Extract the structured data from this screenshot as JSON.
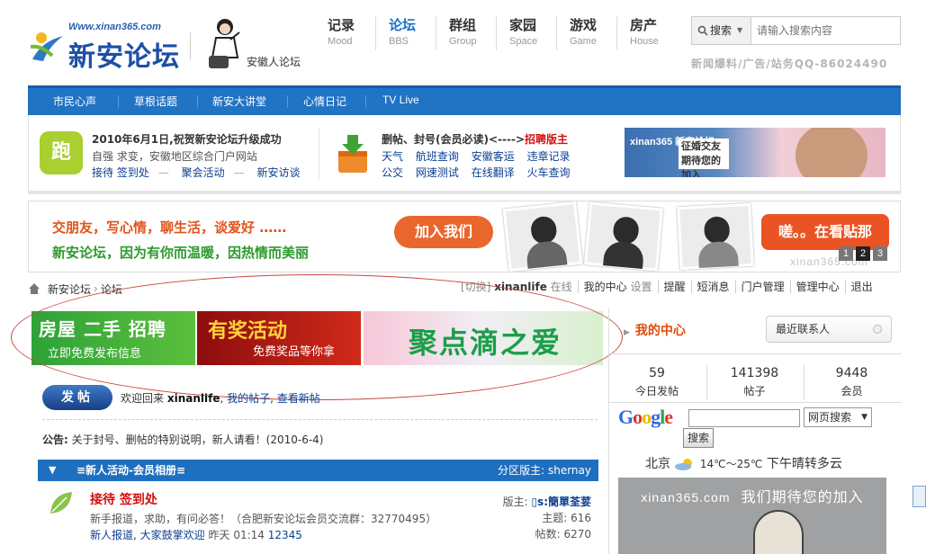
{
  "brand": {
    "url": "Www.xinan365.com",
    "name": "新安论坛",
    "sub_logo_text": "安徽人论坛"
  },
  "topnav": [
    {
      "cn": "记录",
      "en": "Mood",
      "active": false
    },
    {
      "cn": "论坛",
      "en": "BBS",
      "active": true
    },
    {
      "cn": "群组",
      "en": "Group",
      "active": false
    },
    {
      "cn": "家园",
      "en": "Space",
      "active": false
    },
    {
      "cn": "游戏",
      "en": "Game",
      "active": false
    },
    {
      "cn": "房产",
      "en": "House",
      "active": false
    }
  ],
  "search": {
    "type_label": "搜索",
    "placeholder": "请输入搜索内容",
    "hotline": "新闻爆料/广告/站务QQ-86024490"
  },
  "menu": [
    "市民心声",
    "草根话题",
    "新安大讲堂",
    "心情日记",
    "TV Live"
  ],
  "notice": {
    "icon1_text": "跑",
    "title1": "2010年6月1日,祝贺新安论坛升级成功",
    "line1": "自强 求变，安徽地区综合门户网站",
    "links1": [
      "接待 签到处",
      "聚会活动",
      "新安访谈"
    ],
    "title2_a": "删帖、封号(会员必读)<---->",
    "title2_b": "招聘版主",
    "links2_row1": [
      "天气",
      "航班查询",
      "安徽客运",
      "违章记录"
    ],
    "links2_row2": [
      "公交",
      "网速测试",
      "在线翻译",
      "火车查询"
    ],
    "ad_brand": "xinan365 新安论坛",
    "ad_text": "征婚交友 期待您的加入"
  },
  "banner": {
    "line1": "交朋友，写心情，聊生活，谈爱好 ……",
    "line2": "新安论坛，因为有你而温暖，因热情而美丽",
    "join": "加入我们",
    "look": "嗟。。在看贴那",
    "pages": [
      "1",
      "2",
      "3"
    ],
    "watermark": "xinan365.com"
  },
  "crumb": {
    "home": "新安论坛",
    "sep": "›",
    "current": "论坛"
  },
  "userbar": {
    "switch": "[切换]",
    "user": "xinanlife",
    "status": "在线",
    "items": [
      "我的中心",
      "设置",
      "提醒",
      "短消息",
      "门户管理",
      "管理中心",
      "退出"
    ]
  },
  "tiles": {
    "t1_big": "房屋 二手 招聘",
    "t1_small": "立即免费发布信息",
    "t2_big": "有奖活动",
    "t2_small": "免费奖品等你拿",
    "t3_big": "聚点滴之爱"
  },
  "post_btn": "发帖",
  "welcome": {
    "prefix": "欢迎回来",
    "user": "xinanlife",
    "my_posts": "我的帖子",
    "new_posts": "查看新帖"
  },
  "announce": {
    "label": "公告:",
    "text": "关于封号、删帖的特别说明，新人请看！(2010-6-4)"
  },
  "section": {
    "title": "≡新人活动-会员相册≡",
    "moderator": "分区版主: shernay"
  },
  "forum": {
    "name": "接待 签到处",
    "desc": "新手报道，求助，有问必答！（合肥新安论坛会员交流群：32770495）",
    "sub1": "新人报道",
    "sub2": "大家鼓掌欢迎",
    "time": "昨天 01:14",
    "last_id": "12345",
    "mod_label": "版主:",
    "mod_name": "▯s:簡單荃荽",
    "topics_label": "主题:",
    "topics": "616",
    "posts_label": "帖数:",
    "posts": "6270"
  },
  "right": {
    "my_center": "我的中心",
    "contacts": "最近联系人",
    "stats": [
      {
        "value": "59",
        "label": "今日发帖"
      },
      {
        "value": "141398",
        "label": "帖子"
      },
      {
        "value": "9448",
        "label": "会员"
      }
    ],
    "google": "Google",
    "google_select": "网页搜索",
    "google_btn": "搜索",
    "weather": {
      "city": "北京",
      "temp": "14℃～25℃",
      "desc": "下午晴转多云"
    },
    "join_ad": {
      "url": "xinan365.com",
      "text": "我们期待您的加入"
    }
  },
  "colors": {
    "brand_blue": "#2173c4",
    "accent_red": "#d21010",
    "accent_orange": "#e04b0c"
  }
}
